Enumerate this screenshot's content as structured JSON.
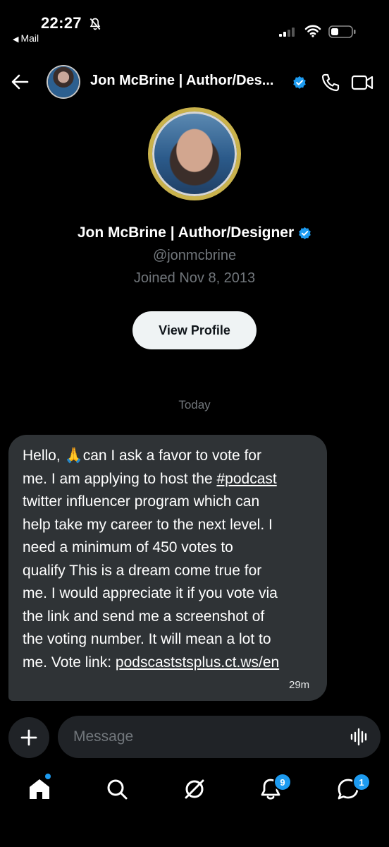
{
  "status_bar": {
    "time": "22:27",
    "back_app": "Mail"
  },
  "header": {
    "name": "Jon McBrine | Author/Des...",
    "verified": true
  },
  "profile": {
    "name": "Jon McBrine | Author/Designer",
    "handle": "@jonmcbrine",
    "joined": "Joined Nov 8, 2013",
    "view_profile_label": "View Profile"
  },
  "conversation": {
    "date_separator": "Today",
    "message": {
      "lines": [
        "can I ask a favor to vote for",
        "me. I am applying to host the ",
        "twitter influencer program which can",
        "help take my career to the next level. I",
        "need a minimum of 450 votes to",
        "qualify This is a dream come true for",
        "me. I would appreciate it if you vote via",
        "the link and send me a screenshot of",
        "the voting number. It will mean a lot to",
        "me. Vote link: "
      ],
      "greeting": "Hello, ",
      "emoji": "🙏",
      "hashtag": "#podcast",
      "link": "podscaststsplus.ct.ws/en",
      "time": "29m"
    }
  },
  "composer": {
    "placeholder": "Message"
  },
  "nav": {
    "notifications_badge": "9",
    "messages_badge": "1"
  },
  "colors": {
    "accent": "#1d9bf0",
    "bubble": "#2f3336",
    "muted": "#71767b"
  }
}
